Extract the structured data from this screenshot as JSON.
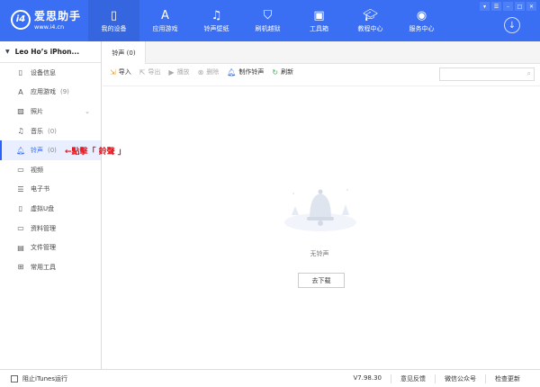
{
  "header": {
    "logo_name": "爱思助手",
    "logo_url": "www.i4.cn",
    "logo_mark": "i4",
    "nav": [
      {
        "label": "我的设备",
        "icon": "phone-icon"
      },
      {
        "label": "应用游戏",
        "icon": "app-store-icon"
      },
      {
        "label": "铃声壁纸",
        "icon": "music-wallpaper-icon"
      },
      {
        "label": "刷机越狱",
        "icon": "shield-icon"
      },
      {
        "label": "工具箱",
        "icon": "toolbox-icon"
      },
      {
        "label": "教程中心",
        "icon": "graduation-cap-icon"
      },
      {
        "label": "服务中心",
        "icon": "compass-icon"
      }
    ]
  },
  "sidebar": {
    "device": "Leo Ho’s iPhon...",
    "items": [
      {
        "label": "设备信息",
        "count": ""
      },
      {
        "label": "应用游戏",
        "count": "(9)"
      },
      {
        "label": "照片",
        "count": ""
      },
      {
        "label": "音乐",
        "count": "(0)"
      },
      {
        "label": "铃声",
        "count": "(0)"
      },
      {
        "label": "视频",
        "count": ""
      },
      {
        "label": "电子书",
        "count": ""
      },
      {
        "label": "虚拟U盘",
        "count": ""
      },
      {
        "label": "资料管理",
        "count": ""
      },
      {
        "label": "文件管理",
        "count": ""
      },
      {
        "label": "常用工具",
        "count": ""
      }
    ]
  },
  "annotation": "←點擊「 鈴聲 」",
  "tab": "铃声 (0)",
  "toolbar": {
    "import": "导入",
    "export": "导出",
    "play": "播放",
    "delete": "删除",
    "make": "制作铃声",
    "refresh": "刷新"
  },
  "search": {
    "placeholder": ""
  },
  "empty": {
    "text": "无铃声",
    "button": "去下载"
  },
  "footer": {
    "itunes": "阻止iTunes运行",
    "version": "V7.98.30",
    "feedback": "意见反馈",
    "wechat": "微信公众号",
    "update": "检查更新"
  },
  "colors": {
    "brand": "#3b6ff3",
    "annotation": "#e8101a"
  }
}
